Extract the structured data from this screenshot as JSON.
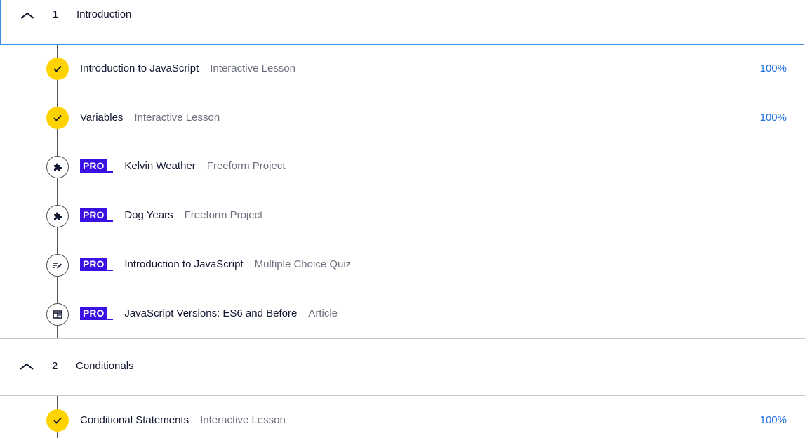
{
  "sections": [
    {
      "number": "1",
      "title": "Introduction",
      "items": [
        {
          "title": "Introduction to JavaScript",
          "type": "Interactive Lesson",
          "progress": "100%",
          "status": "complete",
          "icon": "check-icon",
          "pro": false
        },
        {
          "title": "Variables",
          "type": "Interactive Lesson",
          "progress": "100%",
          "status": "complete",
          "icon": "check-icon",
          "pro": false
        },
        {
          "title": "Kelvin Weather",
          "type": "Freeform Project",
          "progress": "",
          "status": "locked",
          "icon": "puzzle-icon",
          "pro": true,
          "pro_label": "PRO"
        },
        {
          "title": "Dog Years",
          "type": "Freeform Project",
          "progress": "",
          "status": "locked",
          "icon": "puzzle-icon",
          "pro": true,
          "pro_label": "PRO"
        },
        {
          "title": "Introduction to JavaScript",
          "type": "Multiple Choice Quiz",
          "progress": "",
          "status": "locked",
          "icon": "quiz-pencil-icon",
          "pro": true,
          "pro_label": "PRO"
        },
        {
          "title": "JavaScript Versions: ES6 and Before",
          "type": "Article",
          "progress": "",
          "status": "locked",
          "icon": "article-icon",
          "pro": true,
          "pro_label": "PRO"
        }
      ]
    },
    {
      "number": "2",
      "title": "Conditionals",
      "items": [
        {
          "title": "Conditional Statements",
          "type": "Interactive Lesson",
          "progress": "100%",
          "status": "complete",
          "icon": "check-icon",
          "pro": false
        }
      ]
    }
  ],
  "colors": {
    "complete": "#ffd300",
    "pro_badge": "#3a10e5",
    "progress_text": "#1f6fe0",
    "active_border": "#3a8ee6"
  }
}
